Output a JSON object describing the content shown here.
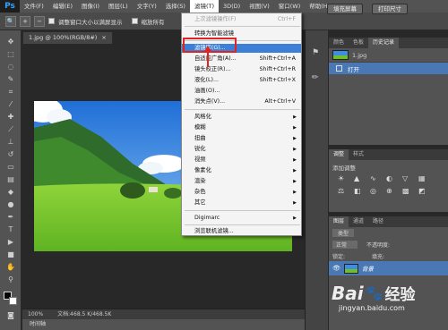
{
  "menubar": {
    "logo": "Ps",
    "items": [
      "文件(F)",
      "编辑(E)",
      "图像(I)",
      "图层(L)",
      "文字(Y)",
      "选择(S)",
      "滤镜(T)",
      "3D(D)",
      "视图(V)",
      "窗口(W)",
      "帮助(H)"
    ]
  },
  "options": {
    "chk1": "调整窗口大小以满屏显示",
    "chk2": "缩放所有",
    "btn_fill": "填充屏幕",
    "btn_print": "打印尺寸"
  },
  "document": {
    "tab_title": "1.jpg @ 100%(RGB/8#)",
    "close": "×",
    "zoom": "100%",
    "doc_info": "文档:468.5 K/468.5K",
    "timeline": "时间轴"
  },
  "filter_menu": {
    "items": [
      {
        "label": "上次滤镜操作(F)",
        "shortcut": "Ctrl+F",
        "disabled": true
      },
      {
        "label": "转换为智能滤镜",
        "shortcut": ""
      },
      {
        "label": "滤镜库(G)...",
        "shortcut": "",
        "highlight": true
      },
      {
        "label": "自适应广角(A)...",
        "shortcut": "Shift+Ctrl+A"
      },
      {
        "label": "镜头校正(R)...",
        "shortcut": "Shift+Ctrl+R"
      },
      {
        "label": "液化(L)...",
        "shortcut": "Shift+Ctrl+X"
      },
      {
        "label": "油画(O)...",
        "shortcut": ""
      },
      {
        "label": "消失点(V)...",
        "shortcut": "Alt+Ctrl+V"
      },
      {
        "label": "风格化",
        "submenu": true
      },
      {
        "label": "模糊",
        "submenu": true
      },
      {
        "label": "扭曲",
        "submenu": true
      },
      {
        "label": "锐化",
        "submenu": true
      },
      {
        "label": "视频",
        "submenu": true
      },
      {
        "label": "像素化",
        "submenu": true
      },
      {
        "label": "渲染",
        "submenu": true
      },
      {
        "label": "杂色",
        "submenu": true
      },
      {
        "label": "其它",
        "submenu": true
      },
      {
        "label": "Digimarc",
        "submenu": true
      },
      {
        "label": "浏览联机滤镜..."
      }
    ]
  },
  "history_panel": {
    "tabs": [
      "颜色",
      "色板",
      "历史记录"
    ],
    "snapshot": "1.jpg",
    "state": "打开"
  },
  "adjust_panel": {
    "tabs": [
      "调整",
      "样式"
    ],
    "title": "添加调整"
  },
  "layers_panel": {
    "tabs": [
      "图层",
      "通道",
      "路径"
    ],
    "kind": "类型",
    "blend": "正常",
    "opacity_label": "不透明度:",
    "lock_label": "锁定:",
    "fill_label": "填充:",
    "layer_name": "背景"
  },
  "watermark": {
    "brand": "Bai",
    "brand2": "经验",
    "url": "jingyan.baidu.com"
  },
  "colors": {
    "highlight": "#3b7fd6",
    "annotation": "#e02424"
  }
}
